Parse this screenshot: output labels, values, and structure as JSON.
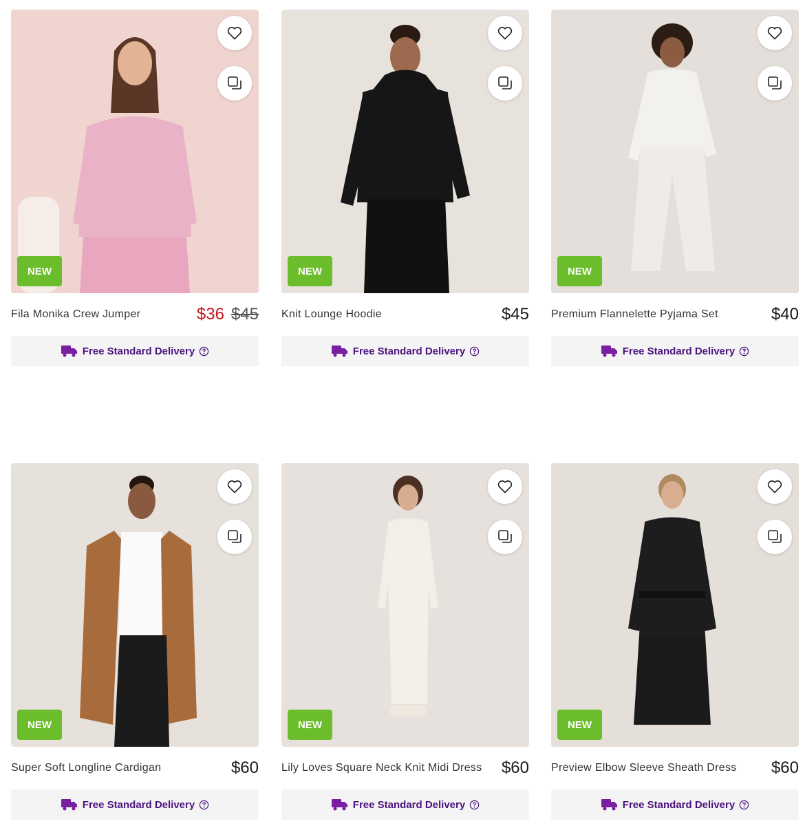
{
  "badge_label": "NEW",
  "delivery_label": "Free Standard Delivery",
  "colors": {
    "badge": "#6cbd2c",
    "sale": "#c8141e",
    "delivery": "#4b127d"
  },
  "icons": {
    "wishlist": "heart-icon",
    "compare": "compare-icon",
    "delivery": "delivery-truck-icon",
    "info": "question-circle-icon"
  },
  "products": [
    {
      "name": "Fila Monika Crew Jumper",
      "price": "$36",
      "was_price": "$45",
      "on_sale": true
    },
    {
      "name": "Knit Lounge Hoodie",
      "price": "$45"
    },
    {
      "name": "Premium Flannelette Pyjama Set",
      "price": "$40"
    },
    {
      "name": "Super Soft Longline Cardigan",
      "price": "$60"
    },
    {
      "name": "Lily Loves Square Neck Knit Midi Dress",
      "price": "$60"
    },
    {
      "name": "Preview Elbow Sleeve Sheath Dress",
      "price": "$60"
    }
  ]
}
